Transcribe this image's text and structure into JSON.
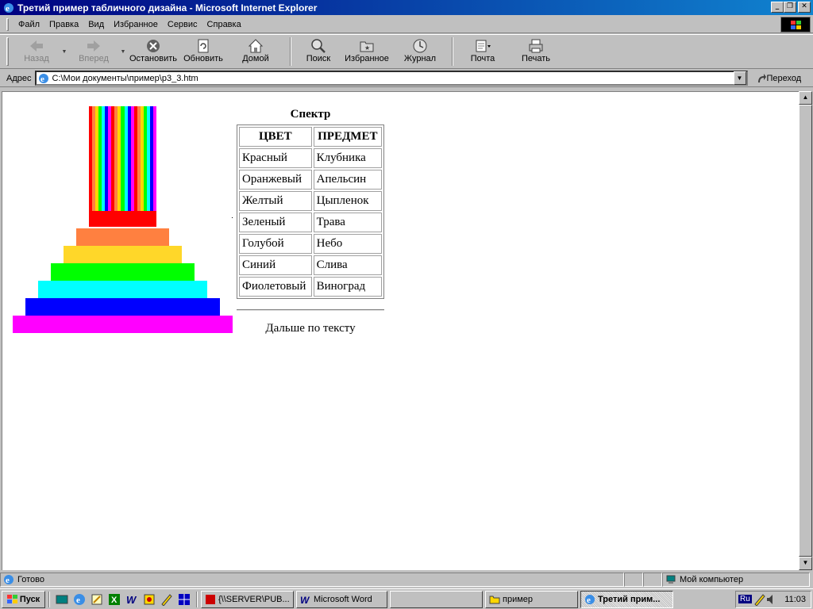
{
  "window": {
    "title": "Третий пример табличного дизайна - Microsoft Internet Explorer"
  },
  "menu": [
    "Файл",
    "Правка",
    "Вид",
    "Избранное",
    "Сервис",
    "Справка"
  ],
  "toolbar": {
    "back": "Назад",
    "forward": "Вперед",
    "stop": "Остановить",
    "refresh": "Обновить",
    "home": "Домой",
    "search": "Поиск",
    "favorites": "Избранное",
    "history": "Журнал",
    "mail": "Почта",
    "print": "Печать"
  },
  "address": {
    "label": "Адрес",
    "url": "C:\\Мои документы\\пример\\p3_3.htm",
    "go": "Переход"
  },
  "page": {
    "caption": "Спектр",
    "headers": [
      "ЦВЕТ",
      "ПРЕДМЕТ"
    ],
    "rows": [
      [
        "Красный",
        "Клубника"
      ],
      [
        "Оранжевый",
        "Апельсин"
      ],
      [
        "Желтый",
        "Цыпленок"
      ],
      [
        "Зеленый",
        "Трава"
      ],
      [
        "Голубой",
        "Небо"
      ],
      [
        "Синий",
        "Слива"
      ],
      [
        "Фиолетовый",
        "Виноград"
      ]
    ],
    "after_text": "Дальше по тексту",
    "stripe_colors": [
      "#ff0000",
      "#ff8040",
      "#ffd700",
      "#00ff00",
      "#00ffff",
      "#0000ff",
      "#ff00ff",
      "#ff0000",
      "#ff8040",
      "#ffd700",
      "#00ff00",
      "#00ffff",
      "#0000ff",
      "#ff00ff",
      "#ff0000",
      "#ff8040",
      "#ffd700",
      "#00ff00",
      "#00ffff",
      "#0000ff",
      "#ff00ff"
    ],
    "pyramid_colors": [
      "#ff0000",
      "#ff8040",
      "#ffd729",
      "#00ff00",
      "#00ffff",
      "#0000ff",
      "#ff00ff"
    ]
  },
  "status": {
    "text": "Готово",
    "zone": "Мой компьютер"
  },
  "taskbar": {
    "start": "Пуск",
    "tasks": [
      "{\\\\SERVER\\PUB...",
      "Microsoft Word",
      "",
      "пример",
      "Третий прим..."
    ],
    "lang": "Ru",
    "clock": "11:03"
  }
}
